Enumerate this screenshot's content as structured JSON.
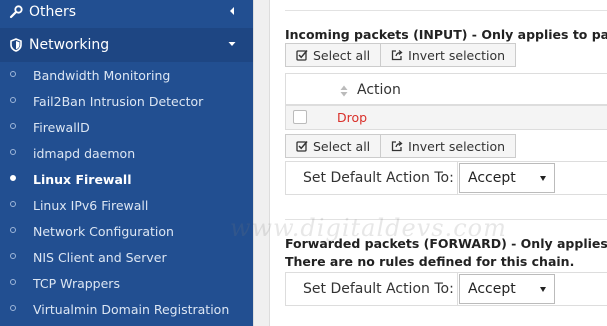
{
  "sidebar": {
    "categories": [
      {
        "label": "Others",
        "icon": "wrench-icon",
        "expanded": false
      },
      {
        "label": "Networking",
        "icon": "shield-icon",
        "expanded": true
      }
    ],
    "items": [
      {
        "label": "Bandwidth Monitoring",
        "active": false
      },
      {
        "label": "Fail2Ban Intrusion Detector",
        "active": false
      },
      {
        "label": "FirewallD",
        "active": false
      },
      {
        "label": "idmapd daemon",
        "active": false
      },
      {
        "label": "Linux Firewall",
        "active": true
      },
      {
        "label": "Linux IPv6 Firewall",
        "active": false
      },
      {
        "label": "Network Configuration",
        "active": false
      },
      {
        "label": "NIS Client and Server",
        "active": false
      },
      {
        "label": "TCP Wrappers",
        "active": false
      },
      {
        "label": "Virtualmin Domain Registration",
        "active": false
      }
    ]
  },
  "input_section": {
    "heading": "Incoming packets (INPUT) - Only applies to packets addr",
    "select_all": "Select all",
    "invert_selection": "Invert selection",
    "column_action": "Action",
    "rows": [
      {
        "action": "Drop"
      }
    ],
    "default_label": "Set Default Action To:",
    "default_value": "Accept"
  },
  "forward_section": {
    "heading": "Forwarded packets (FORWARD) - Only applies to packets",
    "no_rules": "There are no rules defined for this chain.",
    "default_label": "Set Default Action To:",
    "default_value": "Accept"
  },
  "watermark": "www.digitaldevs.com",
  "colors": {
    "sidebar_bg": "#224f91",
    "drop_action": "#d9302a"
  }
}
